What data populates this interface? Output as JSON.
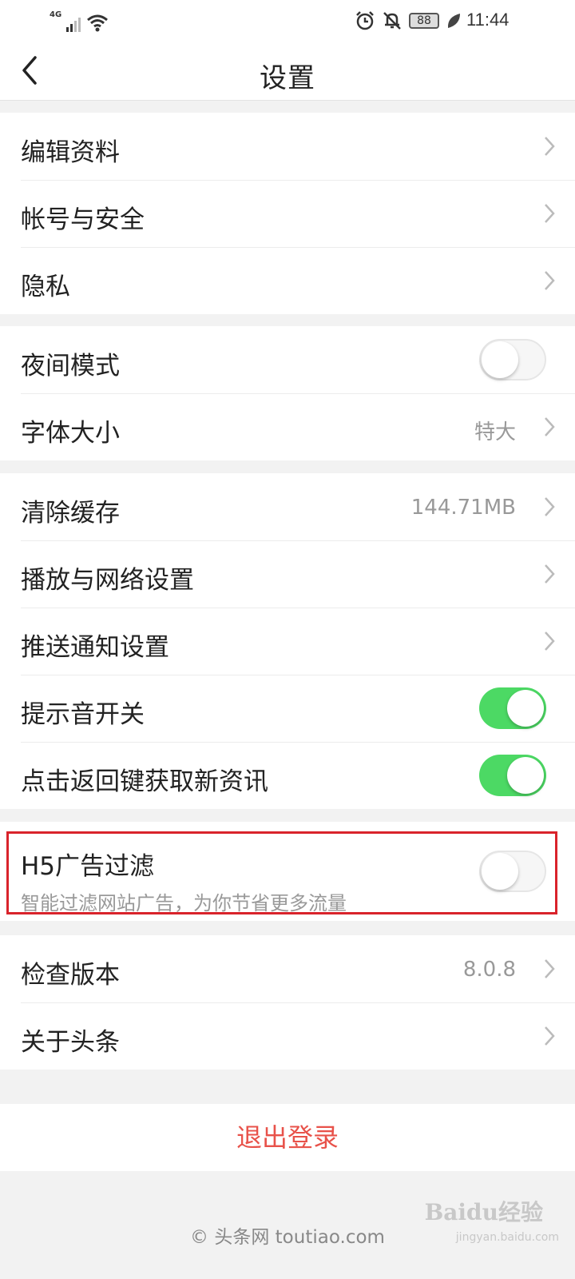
{
  "status_bar": {
    "network": "4G",
    "battery": "88",
    "time": "11:44",
    "icons": [
      "signal-icon",
      "wifi-icon",
      "alarm-icon",
      "mute-icon",
      "battery-icon",
      "leaf-icon"
    ]
  },
  "header": {
    "title": "设置",
    "back_icon": "chevron-left-icon"
  },
  "sections": {
    "account": {
      "edit_profile": "编辑资料",
      "account_security": "帐号与安全",
      "privacy": "隐私"
    },
    "display": {
      "night_mode": "夜间模式",
      "night_mode_on": false,
      "font_size": "字体大小",
      "font_size_value": "特大"
    },
    "system": {
      "clear_cache": "清除缓存",
      "cache_size": "144.71MB",
      "playback_network": "播放与网络设置",
      "push_settings": "推送通知设置",
      "sound_toggle": "提示音开关",
      "sound_toggle_on": true,
      "back_refresh": "点击返回键获取新资讯",
      "back_refresh_on": true
    },
    "ad_filter": {
      "title": "H5广告过滤",
      "subtitle": "智能过滤网站广告，为你节省更多流量",
      "enabled": false
    },
    "about": {
      "check_version": "检查版本",
      "version": "8.0.8",
      "about_toutiao": "关于头条"
    }
  },
  "logout_label": "退出登录",
  "footer": "© 头条网 toutiao.com",
  "watermark": "Baidu经验",
  "watermark_sub": "jingyan.baidu.com",
  "colors": {
    "toggle_on": "#4cd964",
    "logout": "#e8524a",
    "highlight": "#d9232b"
  }
}
